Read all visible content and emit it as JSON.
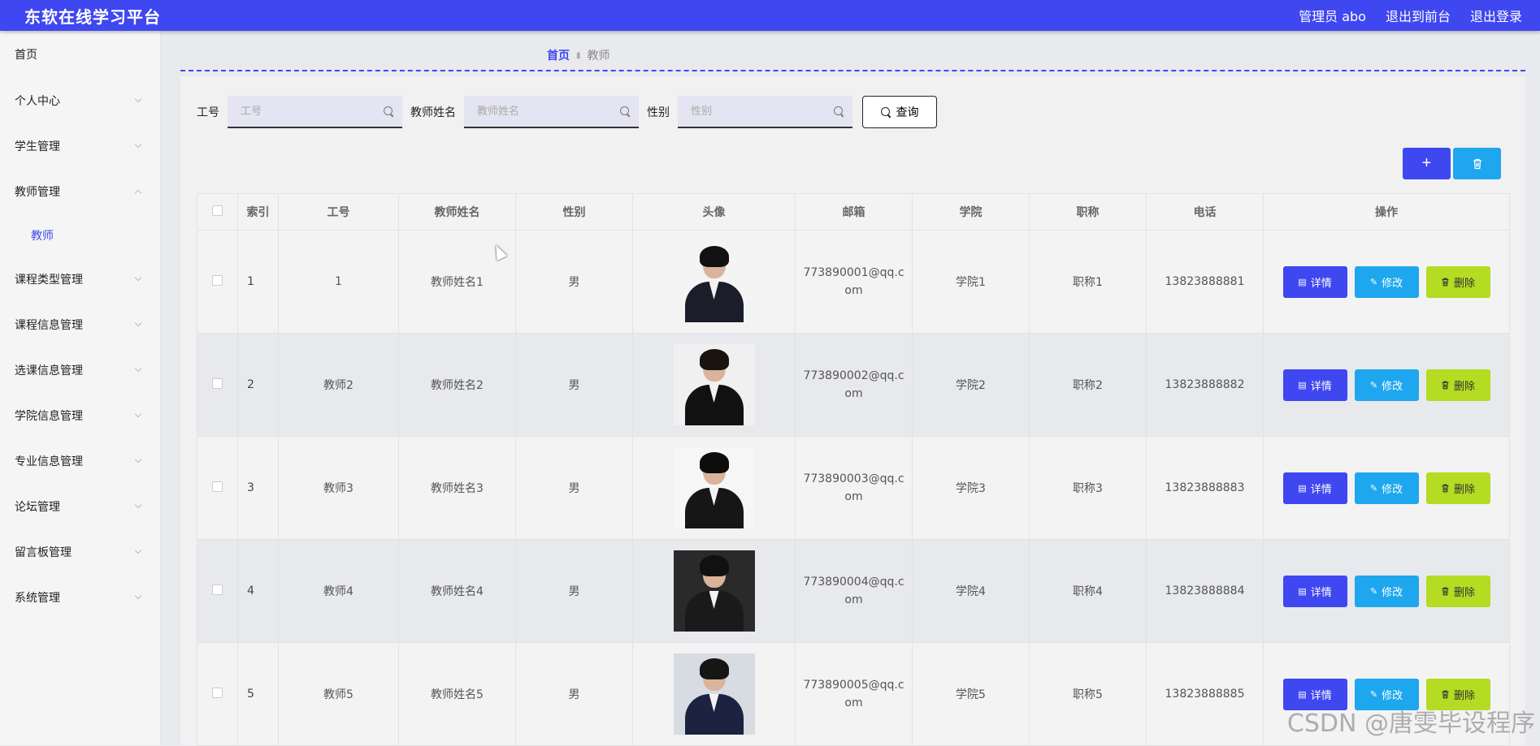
{
  "header": {
    "brand": "东软在线学习平台",
    "admin_label": "管理员 abo",
    "front_link": "退出到前台",
    "logout_link": "退出登录",
    "bg_color": "#3f47f0"
  },
  "sidebar": {
    "items": [
      {
        "label": "首页"
      },
      {
        "label": "个人中心"
      },
      {
        "label": "学生管理"
      },
      {
        "label": "教师管理"
      },
      {
        "label": "课程类型管理"
      },
      {
        "label": "课程信息管理"
      },
      {
        "label": "选课信息管理"
      },
      {
        "label": "学院信息管理"
      },
      {
        "label": "专业信息管理"
      },
      {
        "label": "论坛管理"
      },
      {
        "label": "留言板管理"
      },
      {
        "label": "系统管理"
      }
    ],
    "sub_item": "教师"
  },
  "breadcrumb": {
    "home": "首页",
    "current": "教师"
  },
  "search": {
    "id_label": "工号",
    "id_placeholder": "工号",
    "name_label": "教师姓名",
    "name_placeholder": "教师姓名",
    "gender_label": "性别",
    "gender_placeholder": "性别",
    "query_label": "查询"
  },
  "actions": {
    "add_icon": "+",
    "delete_icon": "trash-icon"
  },
  "table": {
    "headers": [
      "",
      "索引",
      "工号",
      "教师姓名",
      "性别",
      "头像",
      "邮箱",
      "学院",
      "职称",
      "电话",
      "操作"
    ],
    "rows": [
      {
        "index": "1",
        "id": "1",
        "name": "教师姓名1",
        "gender": "男",
        "email_a": "773890001@qq.c",
        "email_b": "om",
        "college": "学院1",
        "title": "职称1",
        "phone": "13823888881"
      },
      {
        "index": "2",
        "id": "教师2",
        "name": "教师姓名2",
        "gender": "男",
        "email_a": "773890002@qq.c",
        "email_b": "om",
        "college": "学院2",
        "title": "职称2",
        "phone": "13823888882"
      },
      {
        "index": "3",
        "id": "教师3",
        "name": "教师姓名3",
        "gender": "男",
        "email_a": "773890003@qq.c",
        "email_b": "om",
        "college": "学院3",
        "title": "职称3",
        "phone": "13823888883"
      },
      {
        "index": "4",
        "id": "教师4",
        "name": "教师姓名4",
        "gender": "男",
        "email_a": "773890004@qq.c",
        "email_b": "om",
        "college": "学院4",
        "title": "职称4",
        "phone": "13823888884"
      },
      {
        "index": "5",
        "id": "教师5",
        "name": "教师姓名5",
        "gender": "男",
        "email_a": "773890005@qq.c",
        "email_b": "om",
        "college": "学院5",
        "title": "职称5",
        "phone": "13823888885"
      }
    ],
    "op_detail": "详情",
    "op_edit": "修改",
    "op_delete": "删除"
  },
  "watermark": "CSDN @唐雯毕设程序"
}
